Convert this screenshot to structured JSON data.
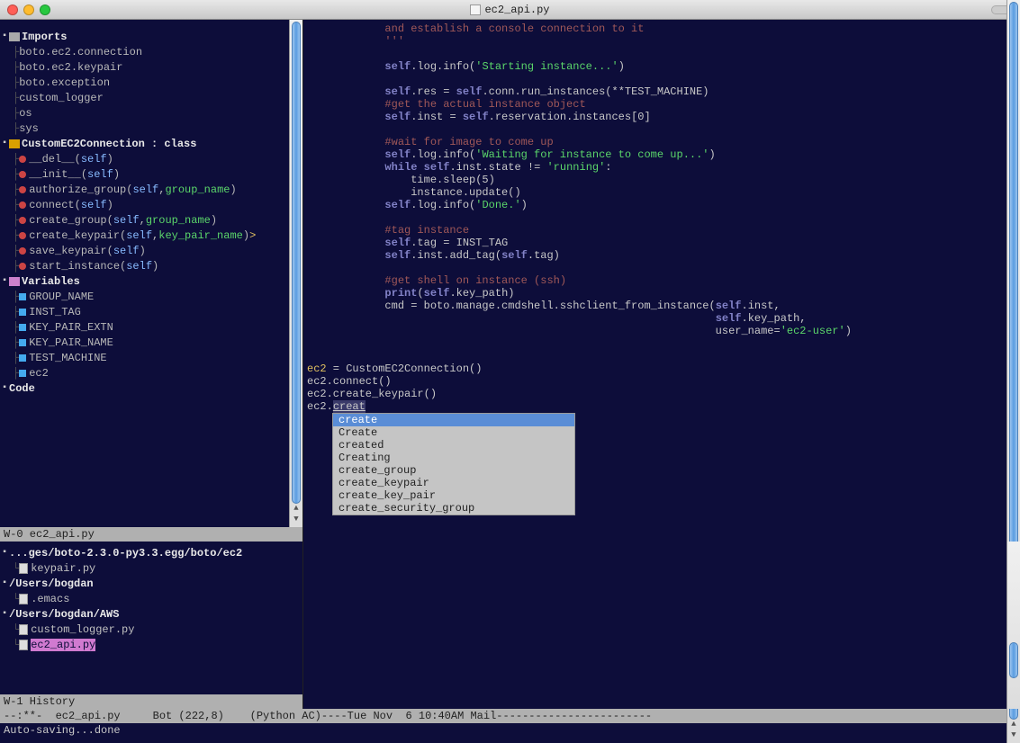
{
  "window": {
    "title": "ec2_api.py"
  },
  "outline": {
    "sections": [
      {
        "title": "Imports",
        "items": [
          "boto.ec2.connection",
          "boto.ec2.keypair",
          "boto.exception",
          "custom_logger",
          "os",
          "sys"
        ]
      },
      {
        "title": "CustomEC2Connection : class",
        "methods": [
          {
            "name": "__del__",
            "params": [
              "self"
            ]
          },
          {
            "name": "__init__",
            "params": [
              "self"
            ]
          },
          {
            "name": "authorize_group",
            "params": [
              "self",
              "group_name"
            ]
          },
          {
            "name": "connect",
            "params": [
              "self"
            ]
          },
          {
            "name": "create_group",
            "params": [
              "self",
              "group_name"
            ]
          },
          {
            "name": "create_keypair",
            "params": [
              "self",
              "key_pair_name"
            ],
            "mark": ">"
          },
          {
            "name": "save_keypair",
            "params": [
              "self"
            ]
          },
          {
            "name": "start_instance",
            "params": [
              "self"
            ]
          }
        ]
      },
      {
        "title": "Variables",
        "items": [
          "GROUP_NAME",
          "INST_TAG",
          "KEY_PAIR_EXTN",
          "KEY_PAIR_NAME",
          "TEST_MACHINE",
          "ec2"
        ]
      },
      {
        "title": "Code"
      }
    ]
  },
  "modeline_left_top": "W-0 ec2_api.py",
  "modeline_left_bottom": "W-1 History",
  "code": {
    "lines": [
      {
        "t": "            and establish a console connection to it",
        "cls": "docstr"
      },
      {
        "t": "            '''",
        "cls": "docstr"
      },
      {
        "t": ""
      },
      {
        "segs": [
          [
            "            ",
            ""
          ],
          [
            "self",
            "self"
          ],
          [
            ".log.info(",
            ""
          ],
          [
            "'Starting instance...'",
            "str"
          ],
          [
            ")",
            ""
          ]
        ]
      },
      {
        "t": ""
      },
      {
        "segs": [
          [
            "            ",
            ""
          ],
          [
            "self",
            "self"
          ],
          [
            ".res = ",
            ""
          ],
          [
            "self",
            "self"
          ],
          [
            ".conn.run_instances(**TEST_MACHINE)",
            ""
          ]
        ]
      },
      {
        "t": "            #get the actual instance object",
        "cls": "comment"
      },
      {
        "segs": [
          [
            "            ",
            ""
          ],
          [
            "self",
            "self"
          ],
          [
            ".inst = ",
            ""
          ],
          [
            "self",
            "self"
          ],
          [
            ".reservation.instances[0]",
            ""
          ]
        ]
      },
      {
        "t": ""
      },
      {
        "t": "            #wait for image to come up",
        "cls": "comment"
      },
      {
        "segs": [
          [
            "            ",
            ""
          ],
          [
            "self",
            "self"
          ],
          [
            ".log.info(",
            ""
          ],
          [
            "'Waiting for instance to come up...'",
            "str"
          ],
          [
            ")",
            ""
          ]
        ]
      },
      {
        "segs": [
          [
            "            ",
            ""
          ],
          [
            "while ",
            "kw"
          ],
          [
            "self",
            "self"
          ],
          [
            ".inst.state != ",
            ""
          ],
          [
            "'running'",
            "str"
          ],
          [
            ":",
            ""
          ]
        ]
      },
      {
        "t": "                time.sleep(5)"
      },
      {
        "t": "                instance.update()"
      },
      {
        "segs": [
          [
            "            ",
            ""
          ],
          [
            "self",
            "self"
          ],
          [
            ".log.info(",
            ""
          ],
          [
            "'Done.'",
            "str"
          ],
          [
            ")",
            ""
          ]
        ]
      },
      {
        "t": ""
      },
      {
        "t": "            #tag instance",
        "cls": "comment"
      },
      {
        "segs": [
          [
            "            ",
            ""
          ],
          [
            "self",
            "self"
          ],
          [
            ".tag = INST_TAG",
            ""
          ]
        ]
      },
      {
        "segs": [
          [
            "            ",
            ""
          ],
          [
            "self",
            "self"
          ],
          [
            ".inst.add_tag(",
            ""
          ],
          [
            "self",
            "self"
          ],
          [
            ".tag)",
            ""
          ]
        ]
      },
      {
        "t": ""
      },
      {
        "t": "            #get shell on instance (ssh)",
        "cls": "comment"
      },
      {
        "segs": [
          [
            "            ",
            ""
          ],
          [
            "print",
            "kw"
          ],
          [
            "(",
            ""
          ],
          [
            "self",
            "self"
          ],
          [
            ".key_path)",
            ""
          ]
        ]
      },
      {
        "segs": [
          [
            "            cmd = boto.manage.cmdshell.sshclient_from_instance(",
            ""
          ],
          [
            "self",
            "self"
          ],
          [
            ".inst,",
            ""
          ]
        ]
      },
      {
        "segs": [
          [
            "                                                               ",
            ""
          ],
          [
            "self",
            "self"
          ],
          [
            ".key_path,",
            ""
          ]
        ]
      },
      {
        "segs": [
          [
            "                                                               user_name=",
            ""
          ],
          [
            "'ec2-user'",
            "str"
          ],
          [
            ")",
            ""
          ]
        ]
      },
      {
        "t": ""
      },
      {
        "t": ""
      },
      {
        "segs": [
          [
            "ec2",
            "ident-y"
          ],
          [
            " = CustomEC2Connection()",
            ""
          ]
        ]
      },
      {
        "t": "ec2.connect()"
      },
      {
        "t": "ec2.create_keypair()"
      },
      {
        "segs": [
          [
            "ec2.",
            ""
          ],
          [
            "creat",
            "hl"
          ]
        ]
      }
    ]
  },
  "completion": {
    "items": [
      "create",
      "Create",
      "created",
      "Creating",
      "create_group",
      "create_keypair",
      "create_key_pair",
      "create_security_group"
    ],
    "selected": 0
  },
  "history": {
    "groups": [
      {
        "title": "...ges/boto-2.3.0-py3.3.egg/boto/ec2",
        "files": [
          "keypair.py"
        ]
      },
      {
        "title": "/Users/bogdan",
        "files": [
          ".emacs"
        ]
      },
      {
        "title": "/Users/bogdan/AWS",
        "files": [
          "custom_logger.py",
          "ec2_api.py"
        ],
        "selected": "ec2_api.py"
      }
    ]
  },
  "status_line": "--:**-  ec2_api.py     Bot (222,8)    (Python AC)----Tue Nov  6 10:40AM Mail------------------------",
  "minibuffer": "Auto-saving...done"
}
